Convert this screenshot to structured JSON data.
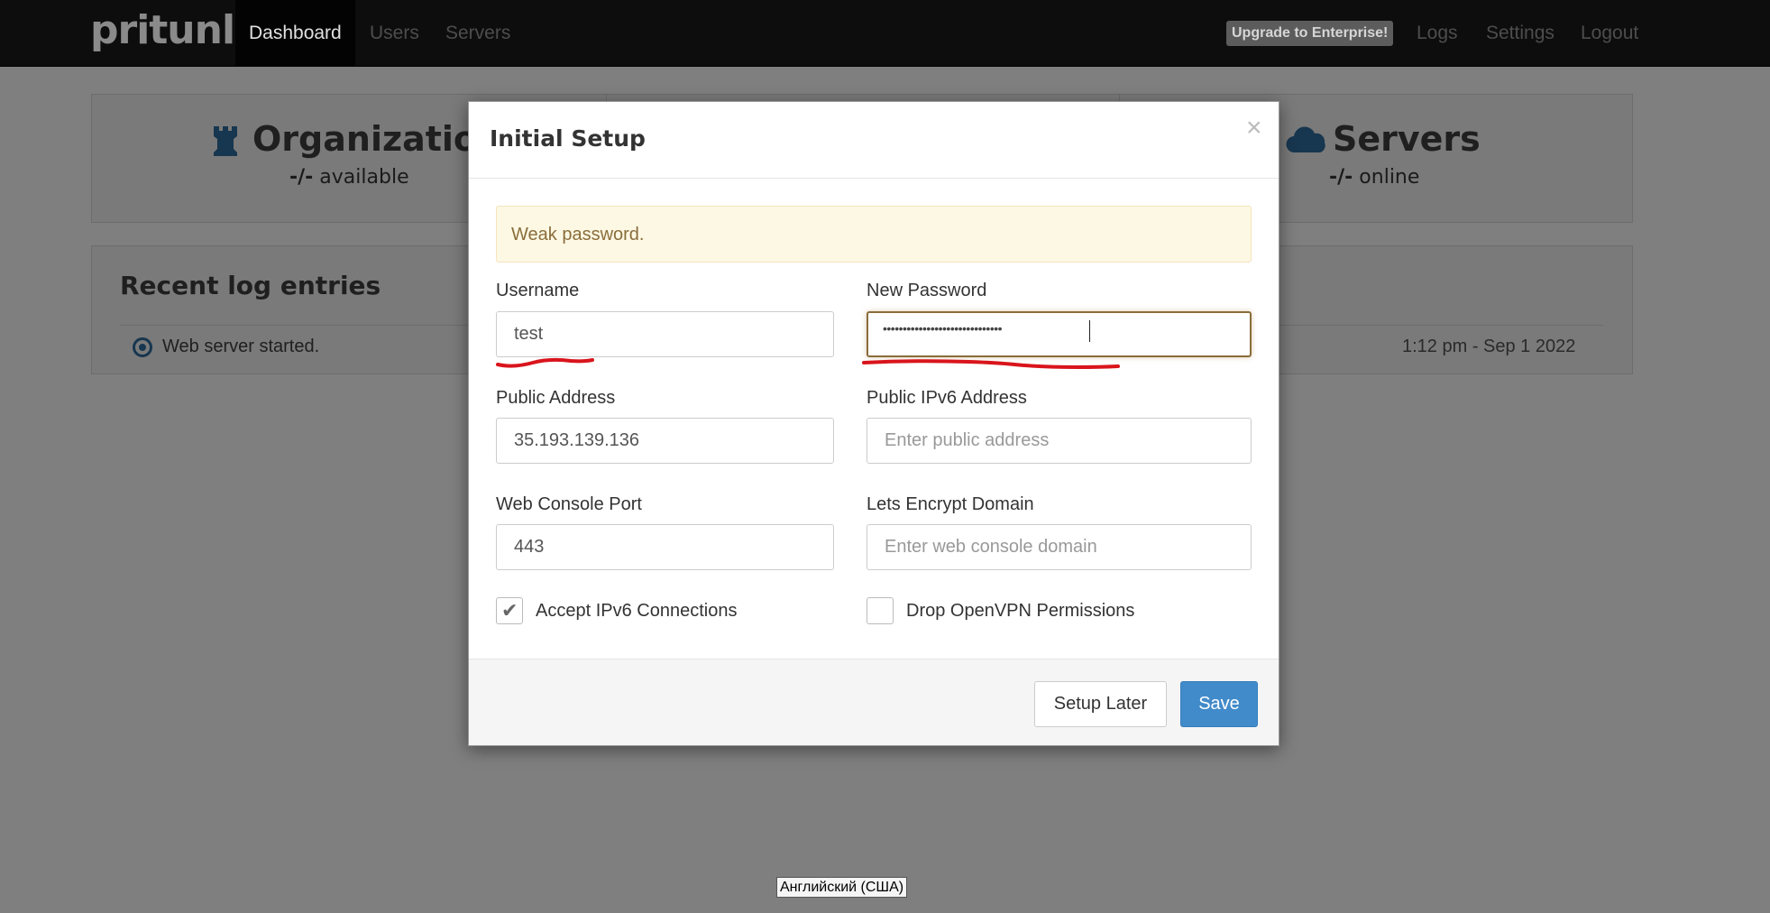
{
  "navbar": {
    "brand": "pritunl",
    "items": [
      {
        "label": "Dashboard",
        "active": true
      },
      {
        "label": "Users"
      },
      {
        "label": "Servers"
      }
    ],
    "upgrade_label": "Upgrade to Enterprise!",
    "right_items": [
      "Logs",
      "Settings",
      "Logout"
    ]
  },
  "dashboard": {
    "organizations": {
      "title": "Organization",
      "dash": "-/-",
      "status": "available",
      "icon": "rook-icon"
    },
    "servers": {
      "title": "Servers",
      "dash": "-/-",
      "status": "online",
      "icon": "cloud-icon"
    },
    "log": {
      "heading": "Recent log entries",
      "entries": [
        {
          "message": "Web server started.",
          "time": "1:12 pm - Sep 1 2022"
        }
      ]
    }
  },
  "modal": {
    "title": "Initial Setup",
    "close_glyph": "×",
    "alert": "Weak password.",
    "username": {
      "label": "Username",
      "value": "test"
    },
    "new_password": {
      "label": "New Password",
      "masked_value": "••••••••••••••••••••••••••••••"
    },
    "public_address": {
      "label": "Public Address",
      "value": "35.193.139.136"
    },
    "public_ipv6": {
      "label": "Public IPv6 Address",
      "placeholder": "Enter public address"
    },
    "web_console_port": {
      "label": "Web Console Port",
      "value": "443"
    },
    "lets_encrypt": {
      "label": "Lets Encrypt Domain",
      "placeholder": "Enter web console domain"
    },
    "accept_ipv6": {
      "label": "Accept IPv6 Connections",
      "checked": true
    },
    "drop_openvpn": {
      "label": "Drop OpenVPN Permissions",
      "checked": false
    },
    "buttons": {
      "setup_later": "Setup Later",
      "save": "Save"
    }
  },
  "language_indicator": "Английский (США)",
  "colors": {
    "primary": "#428bca",
    "warning_bg": "#fcf8e3",
    "warning_text": "#8a6d3b",
    "annotation": "#d9141c"
  }
}
